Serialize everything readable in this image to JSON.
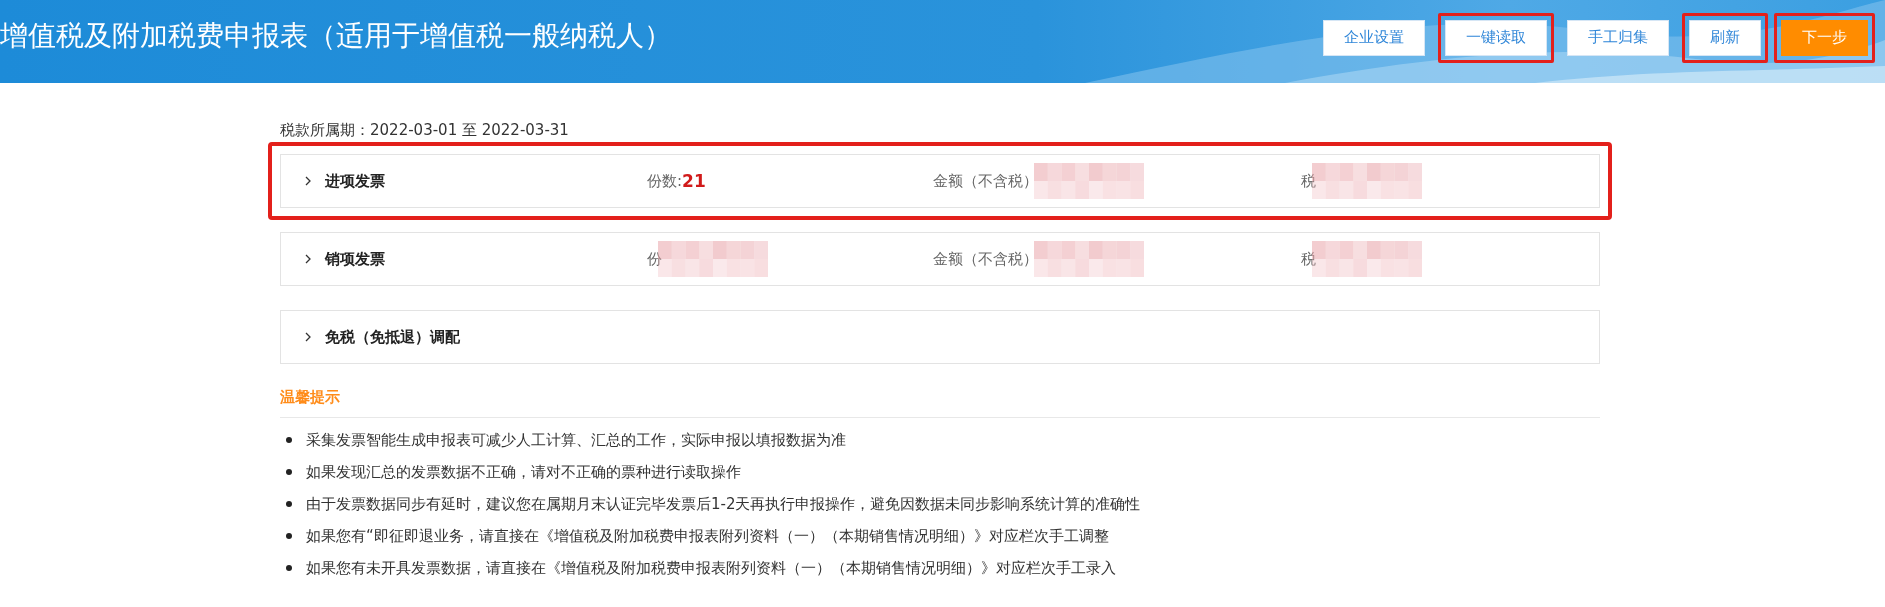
{
  "header": {
    "title": "增值税及附加税费申报表（适用于增值税一般纳税人）"
  },
  "buttons": [
    {
      "label": "企业设置",
      "kind": "plain",
      "highlighted": false
    },
    {
      "label": "一键读取",
      "kind": "plain",
      "highlighted": true
    },
    {
      "label": "手工归集",
      "kind": "plain",
      "highlighted": false
    },
    {
      "label": "刷新",
      "kind": "plain",
      "highlighted": true
    },
    {
      "label": "下一步",
      "kind": "primary",
      "highlighted": true
    }
  ],
  "period": "税款所属期：2022-03-01 至 2022-03-31",
  "sections": [
    {
      "title": "进项发票",
      "expanded": false,
      "highlighted": true,
      "fields": [
        {
          "label": "份数:",
          "value": "21",
          "redacted": false
        },
        {
          "label": "金额（不含税）",
          "redacted": true
        },
        {
          "label": "税",
          "redacted": true
        }
      ]
    },
    {
      "title": "销项发票",
      "expanded": false,
      "highlighted": false,
      "fields": [
        {
          "label": "份",
          "redacted": true
        },
        {
          "label": "金额（不含税）",
          "redacted": true
        },
        {
          "label": "税",
          "redacted": true
        }
      ]
    },
    {
      "title": "免税（免抵退）调配",
      "expanded": false,
      "highlighted": false
    }
  ],
  "tips": {
    "title": "温馨提示",
    "items": [
      "采集发票智能生成申报表可减少人工计算、汇总的工作，实际申报以填报数据为准",
      "如果发现汇总的发票数据不正确，请对不正确的票种进行读取操作",
      "由于发票数据同步有延时，建议您在属期月末认证完毕发票后1-2天再执行申报操作，避免因数据未同步影响系统计算的准确性",
      "如果您有“即征即退业务，请直接在《增值税及附加税费申报表附列资料（一）（本期销售情况明细）》对应栏次手工调整",
      "如果您有未开具发票数据，请直接在《增值税及附加税费申报表附列资料（一）（本期销售情况明细）》对应栏次手工录入"
    ]
  }
}
